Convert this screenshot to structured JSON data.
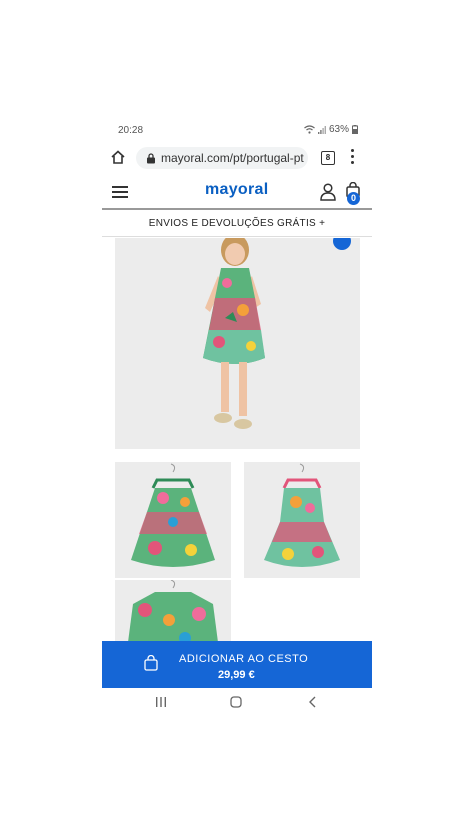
{
  "status": {
    "time": "20:28",
    "battery": "63%"
  },
  "browser": {
    "url": "mayoral.com/pt/portugal-pt",
    "tab_count": "8"
  },
  "header": {
    "logo": "mayoral",
    "bag_count": "0"
  },
  "promo": {
    "text": "ENVIOS E DEVOLUÇÕES GRÁTIS +"
  },
  "cta": {
    "label": "ADICIONAR AO CESTO",
    "price": "29,99 €"
  },
  "colors": {
    "brand_blue": "#1566d6",
    "image_bg": "#ececec"
  },
  "icons": [
    "home-icon",
    "lock-icon",
    "tabs-icon",
    "more-icon",
    "menu-icon",
    "user-icon",
    "bag-icon",
    "recents-icon",
    "home-nav-icon",
    "back-icon"
  ]
}
